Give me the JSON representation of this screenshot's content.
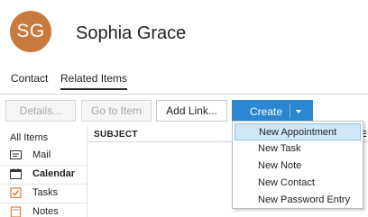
{
  "contact": {
    "initials": "SG",
    "name": "Sophia Grace",
    "avatar_color": "#c97a3e"
  },
  "tabs": [
    {
      "label": "Contact",
      "active": false
    },
    {
      "label": "Related Items",
      "active": true
    }
  ],
  "toolbar": {
    "details_label": "Details...",
    "goto_label": "Go to Item",
    "addlink_label": "Add Link...",
    "create_label": "Create",
    "accent_color": "#2b87d1"
  },
  "sidebar": {
    "header": "All Items",
    "items": [
      {
        "label": "Mail",
        "icon": "mail-icon"
      },
      {
        "label": "Calendar",
        "icon": "calendar-icon",
        "selected": true
      },
      {
        "label": "Tasks",
        "icon": "tasks-icon"
      },
      {
        "label": "Notes",
        "icon": "notes-icon"
      }
    ]
  },
  "grid": {
    "subject_header": "SUBJECT",
    "next_header_fragment": "E"
  },
  "create_menu": {
    "items": [
      {
        "label": "New Appointment",
        "highlighted": true
      },
      {
        "label": "New Task"
      },
      {
        "label": "New Note"
      },
      {
        "label": "New Contact"
      },
      {
        "label": "New Password Entry"
      }
    ]
  }
}
